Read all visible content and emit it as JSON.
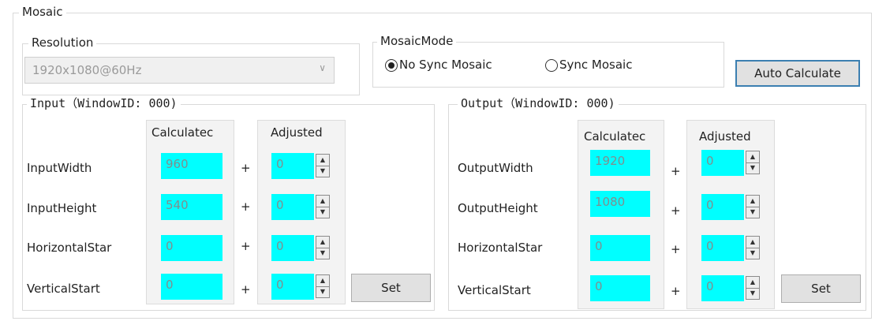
{
  "mosaic": {
    "title": "Mosaic",
    "resolution": {
      "label": "Resolution",
      "value": "1920x1080@60Hz"
    },
    "mode": {
      "label": "MosaicMode",
      "options": [
        "No Sync Mosaic",
        "Sync Mosaic"
      ],
      "selected": "No Sync Mosaic"
    },
    "auto_calculate_label": "Auto Calculate",
    "input": {
      "title": "Input（WindowID: 000)",
      "calculated_header": "Calculatec",
      "adjusted_header": "Adjusted",
      "rows": [
        {
          "label": "InputWidth",
          "calculated": "960",
          "adjusted": "0"
        },
        {
          "label": "InputHeight",
          "calculated": "540",
          "adjusted": "0"
        },
        {
          "label": "HorizontalStar",
          "calculated": "0",
          "adjusted": "0"
        },
        {
          "label": "VerticalStart",
          "calculated": "0",
          "adjusted": "0"
        }
      ],
      "plus": "+",
      "set_label": "Set"
    },
    "output": {
      "title": "Output（WindowID: 000)",
      "calculated_header": "Calculatec",
      "adjusted_header": "Adjusted",
      "rows": [
        {
          "label": "OutputWidth",
          "calculated": "1920",
          "adjusted": "0"
        },
        {
          "label": "OutputHeight",
          "calculated": "1080",
          "adjusted": "0"
        },
        {
          "label": "HorizontalStar",
          "calculated": "0",
          "adjusted": "0"
        },
        {
          "label": "VerticalStart",
          "calculated": "0",
          "adjusted": "0"
        }
      ],
      "plus": "+",
      "set_label": "Set"
    },
    "colors": {
      "field": "#00ffff",
      "field_text": "#7f8f8f",
      "button": "#e1e1e1"
    }
  }
}
